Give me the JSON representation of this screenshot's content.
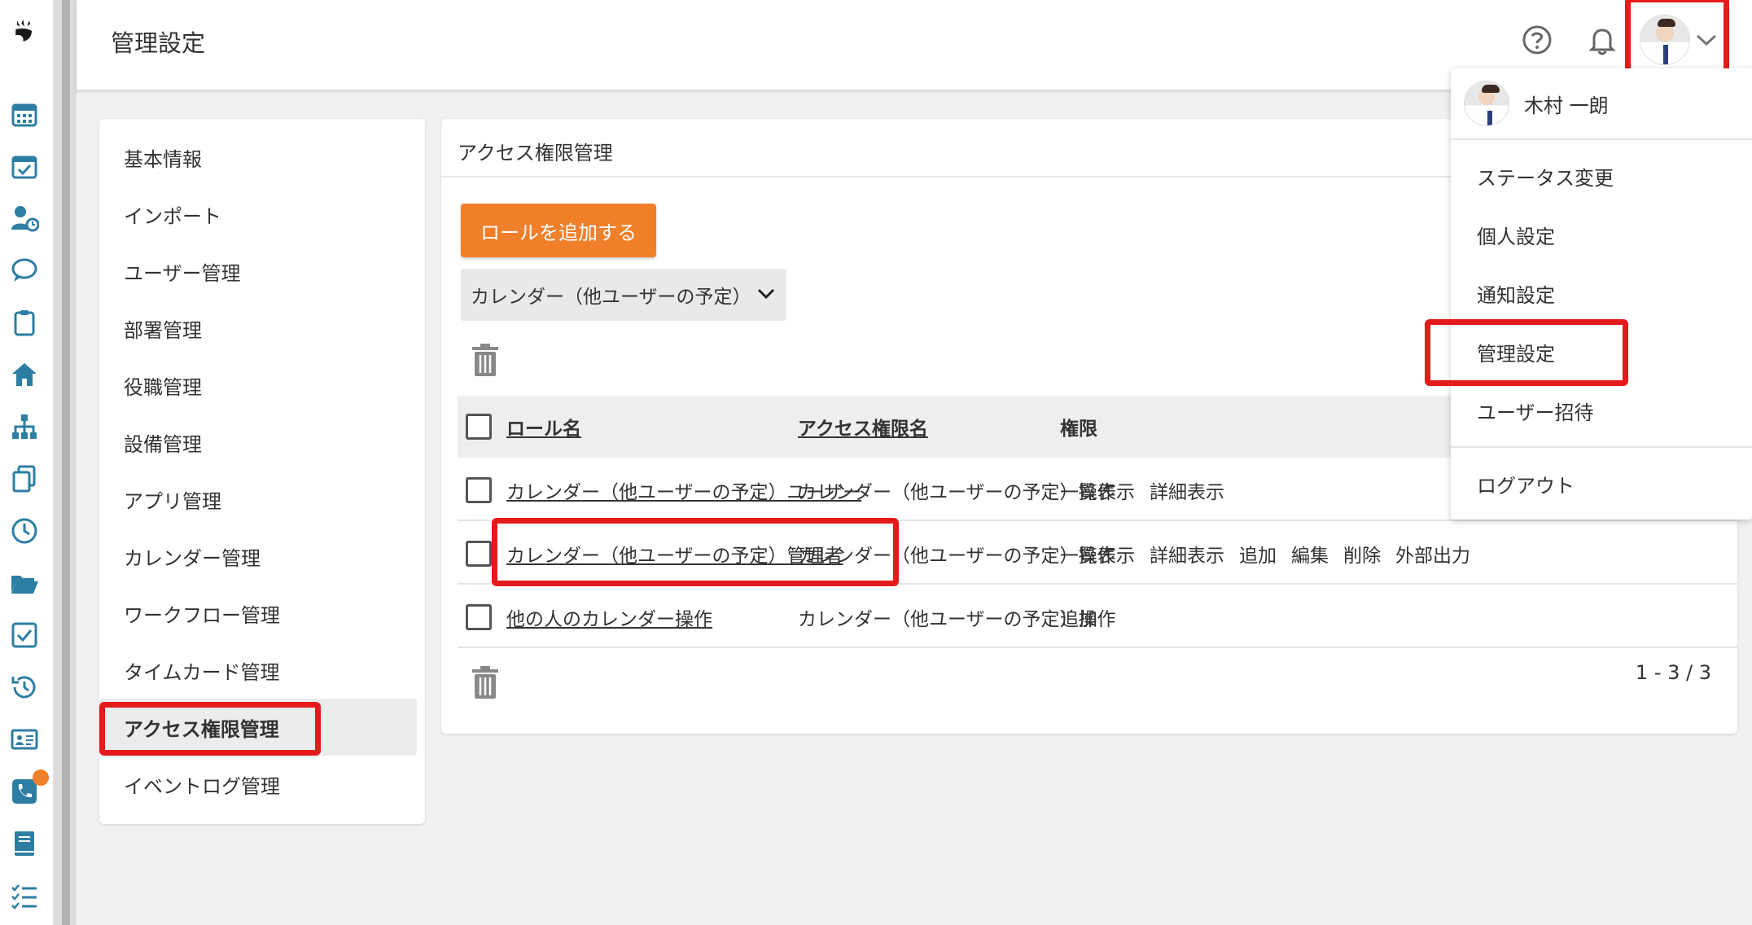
{
  "header": {
    "title": "管理設定",
    "help_icon": "help-circle-icon",
    "bell_icon": "bell-icon"
  },
  "user_menu": {
    "user_name": "木村 一朗",
    "items": [
      "ステータス変更",
      "個人設定",
      "通知設定",
      "管理設定",
      "ユーザー招待",
      "ログアウト"
    ]
  },
  "settings_nav": {
    "items": [
      "基本情報",
      "インポート",
      "ユーザー管理",
      "部署管理",
      "役職管理",
      "設備管理",
      "アプリ管理",
      "カレンダー管理",
      "ワークフロー管理",
      "タイムカード管理",
      "アクセス権限管理",
      "イベントログ管理"
    ],
    "active": "アクセス権限管理"
  },
  "card": {
    "title": "アクセス権限管理",
    "add_button": "ロールを追加する",
    "filter_value": "カレンダー（他ユーザーの予定）",
    "columns": [
      "ロール名",
      "アクセス権限名",
      "権限"
    ],
    "rows": [
      {
        "role": "カレンダー（他ユーザーの予定）ユーザー",
        "access": "カレンダー（他ユーザーの予定）操作",
        "perms": [
          "一覧表示",
          "詳細表示"
        ]
      },
      {
        "role": "カレンダー（他ユーザーの予定）管理者",
        "access": "カレンダー（他ユーザーの予定）操作",
        "perms": [
          "一覧表示",
          "詳細表示",
          "追加",
          "編集",
          "削除",
          "外部出力"
        ]
      },
      {
        "role": "他の人のカレンダー操作",
        "access": "カレンダー（他ユーザーの予定）操作",
        "perms": [
          "追加"
        ]
      }
    ],
    "pager": "1 - 3 / 3"
  },
  "colors": {
    "accent": "#f07f2a",
    "highlight": "#e31b1b"
  }
}
